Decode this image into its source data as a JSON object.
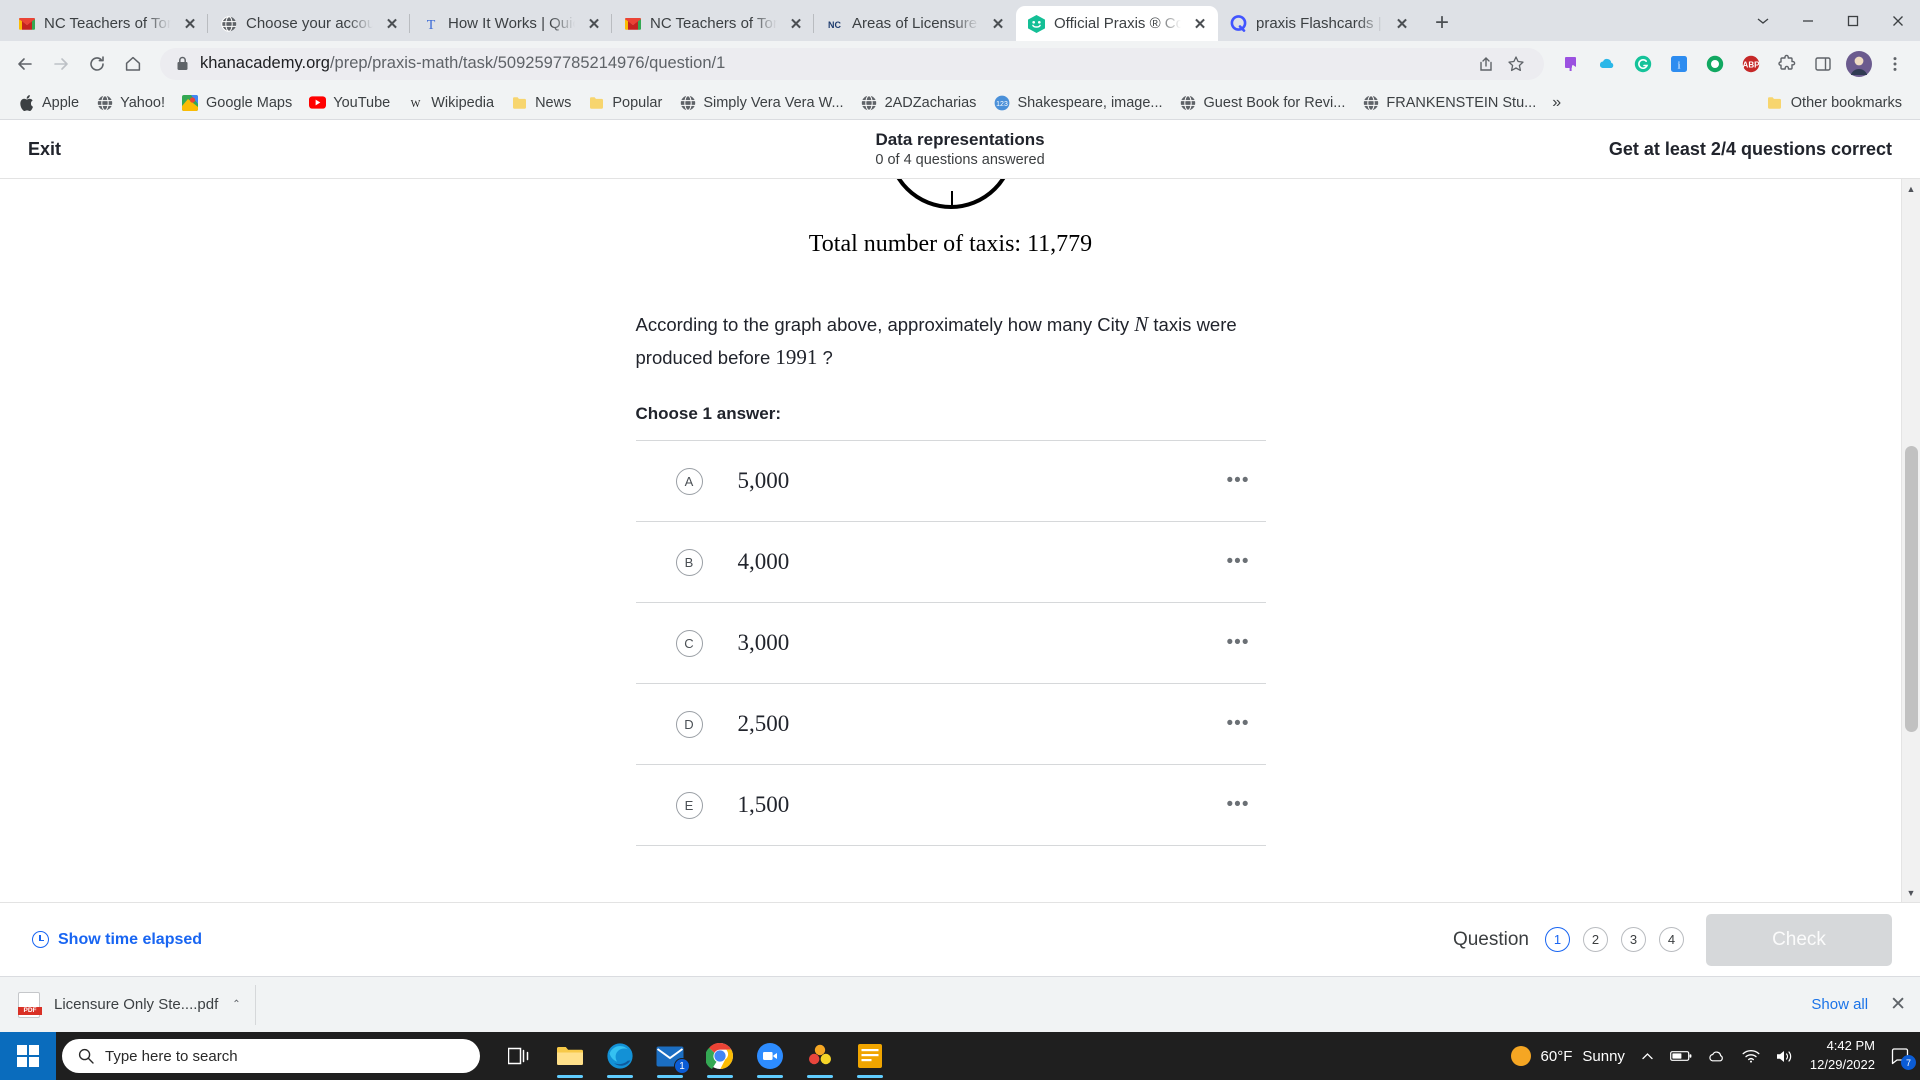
{
  "browser": {
    "tabs": [
      {
        "title": "NC Teachers of Tomorrow",
        "favicon": "gmail-icon",
        "active": false
      },
      {
        "title": "Choose your account",
        "favicon": "globe-icon",
        "active": false
      },
      {
        "title": "How It Works | Quicken",
        "favicon": "t-letter-icon",
        "active": false
      },
      {
        "title": "NC Teachers of Tomorrow",
        "favicon": "gmail-icon",
        "active": false
      },
      {
        "title": "Areas of Licensure | NC",
        "favicon": "nc-icon",
        "active": false
      },
      {
        "title": "Official Praxis ® Core P",
        "favicon": "khan-academy-icon",
        "active": true
      },
      {
        "title": "praxis Flashcards | Quizlet",
        "favicon": "quizlet-icon",
        "active": false
      }
    ],
    "new_tab_label": "+",
    "window_controls": {
      "restore_down": "⌄",
      "minimize": "—",
      "maximize": "❐",
      "close": "✕"
    },
    "nav": {
      "back": "←",
      "forward": "→",
      "reload": "⟳",
      "home": "⌂"
    },
    "address": {
      "lock_icon": "lock-icon",
      "host": "khanacademy.org",
      "path": "/prep/praxis-math/task/5092597785214976/question/1",
      "full_url": "khanacademy.org/prep/praxis-math/task/5092597785214976/question/1"
    },
    "omnibox_actions": [
      "share-icon",
      "bookmark-star-icon"
    ],
    "extensions": [
      "purple-extension-icon",
      "cloud-extension-icon",
      "grammarly-icon",
      "info-icon",
      "honey-icon",
      "adblock-icon",
      "puzzle-extensions-icon",
      "sidepanel-icon",
      "profile-avatar",
      "kebab-menu-icon"
    ],
    "bookmarks": [
      {
        "label": "Apple",
        "icon": "apple-icon"
      },
      {
        "label": "Yahoo!",
        "icon": "globe-icon"
      },
      {
        "label": "Google Maps",
        "icon": "maps-icon"
      },
      {
        "label": "YouTube",
        "icon": "youtube-icon"
      },
      {
        "label": "Wikipedia",
        "icon": "wikipedia-icon"
      },
      {
        "label": "News",
        "icon": "folder-icon"
      },
      {
        "label": "Popular",
        "icon": "folder-icon"
      },
      {
        "label": "Simply Vera Vera W...",
        "icon": "globe-icon"
      },
      {
        "label": "2ADZacharias",
        "icon": "globe-icon"
      },
      {
        "label": "Shakespeare, image...",
        "icon": "123-icon"
      },
      {
        "label": "Guest Book for Revi...",
        "icon": "globe-icon"
      },
      {
        "label": "FRANKENSTEIN Stu...",
        "icon": "globe-icon"
      }
    ],
    "bookmarks_overflow": "»",
    "other_bookmarks": {
      "label": "Other bookmarks",
      "icon": "folder-icon"
    }
  },
  "khan": {
    "exit_label": "Exit",
    "title": "Data representations",
    "progress_text": "0 of 4 questions answered",
    "goal_text": "Get at least 2/4 questions correct",
    "total_taxis_text": "Total number of taxis: 11,779",
    "question_part1": "According to the graph above, approximately how many City ",
    "question_var": "N",
    "question_part2": " taxis were produced before ",
    "question_year": "1991",
    "question_part3": " ?",
    "choose_label": "Choose 1 answer:",
    "choices": [
      {
        "letter": "A",
        "value": "5,000",
        "more": "•••"
      },
      {
        "letter": "B",
        "value": "4,000",
        "more": "•••"
      },
      {
        "letter": "C",
        "value": "3,000",
        "more": "•••"
      },
      {
        "letter": "D",
        "value": "2,500",
        "more": "•••"
      },
      {
        "letter": "E",
        "value": "1,500",
        "more": "•••"
      }
    ],
    "footer": {
      "show_time_label": "Show time elapsed",
      "question_label": "Question",
      "question_dots": [
        "1",
        "2",
        "3",
        "4"
      ],
      "current_question": "1",
      "check_label": "Check"
    },
    "accent_color": "#1865f2",
    "check_disabled_color": "#d6d8da"
  },
  "downloads": {
    "file_name": "Licensure Only Ste....pdf",
    "caret": "⌃",
    "show_all_label": "Show all",
    "close_label": "✕"
  },
  "taskbar": {
    "start_icon": "windows-start-icon",
    "search_placeholder": "Type here to search",
    "search_icon": "search-icon",
    "apps": [
      {
        "name": "task-view-icon",
        "badge": null
      },
      {
        "name": "file-explorer-icon",
        "badge": null
      },
      {
        "name": "microsoft-edge-icon",
        "badge": null
      },
      {
        "name": "mail-icon",
        "badge": "1"
      },
      {
        "name": "google-chrome-icon",
        "badge": null
      },
      {
        "name": "zoom-icon",
        "badge": null
      },
      {
        "name": "photos-icon",
        "badge": null
      },
      {
        "name": "sticky-notes-icon",
        "badge": null
      }
    ],
    "weather_temp": "60°F",
    "weather_desc": "Sunny",
    "tray_icons": [
      "chevron-up-icon",
      "battery-icon",
      "onedrive-icon",
      "wifi-icon",
      "volume-icon"
    ],
    "time": "4:42 PM",
    "date": "12/29/2022",
    "notification_count": "7"
  }
}
